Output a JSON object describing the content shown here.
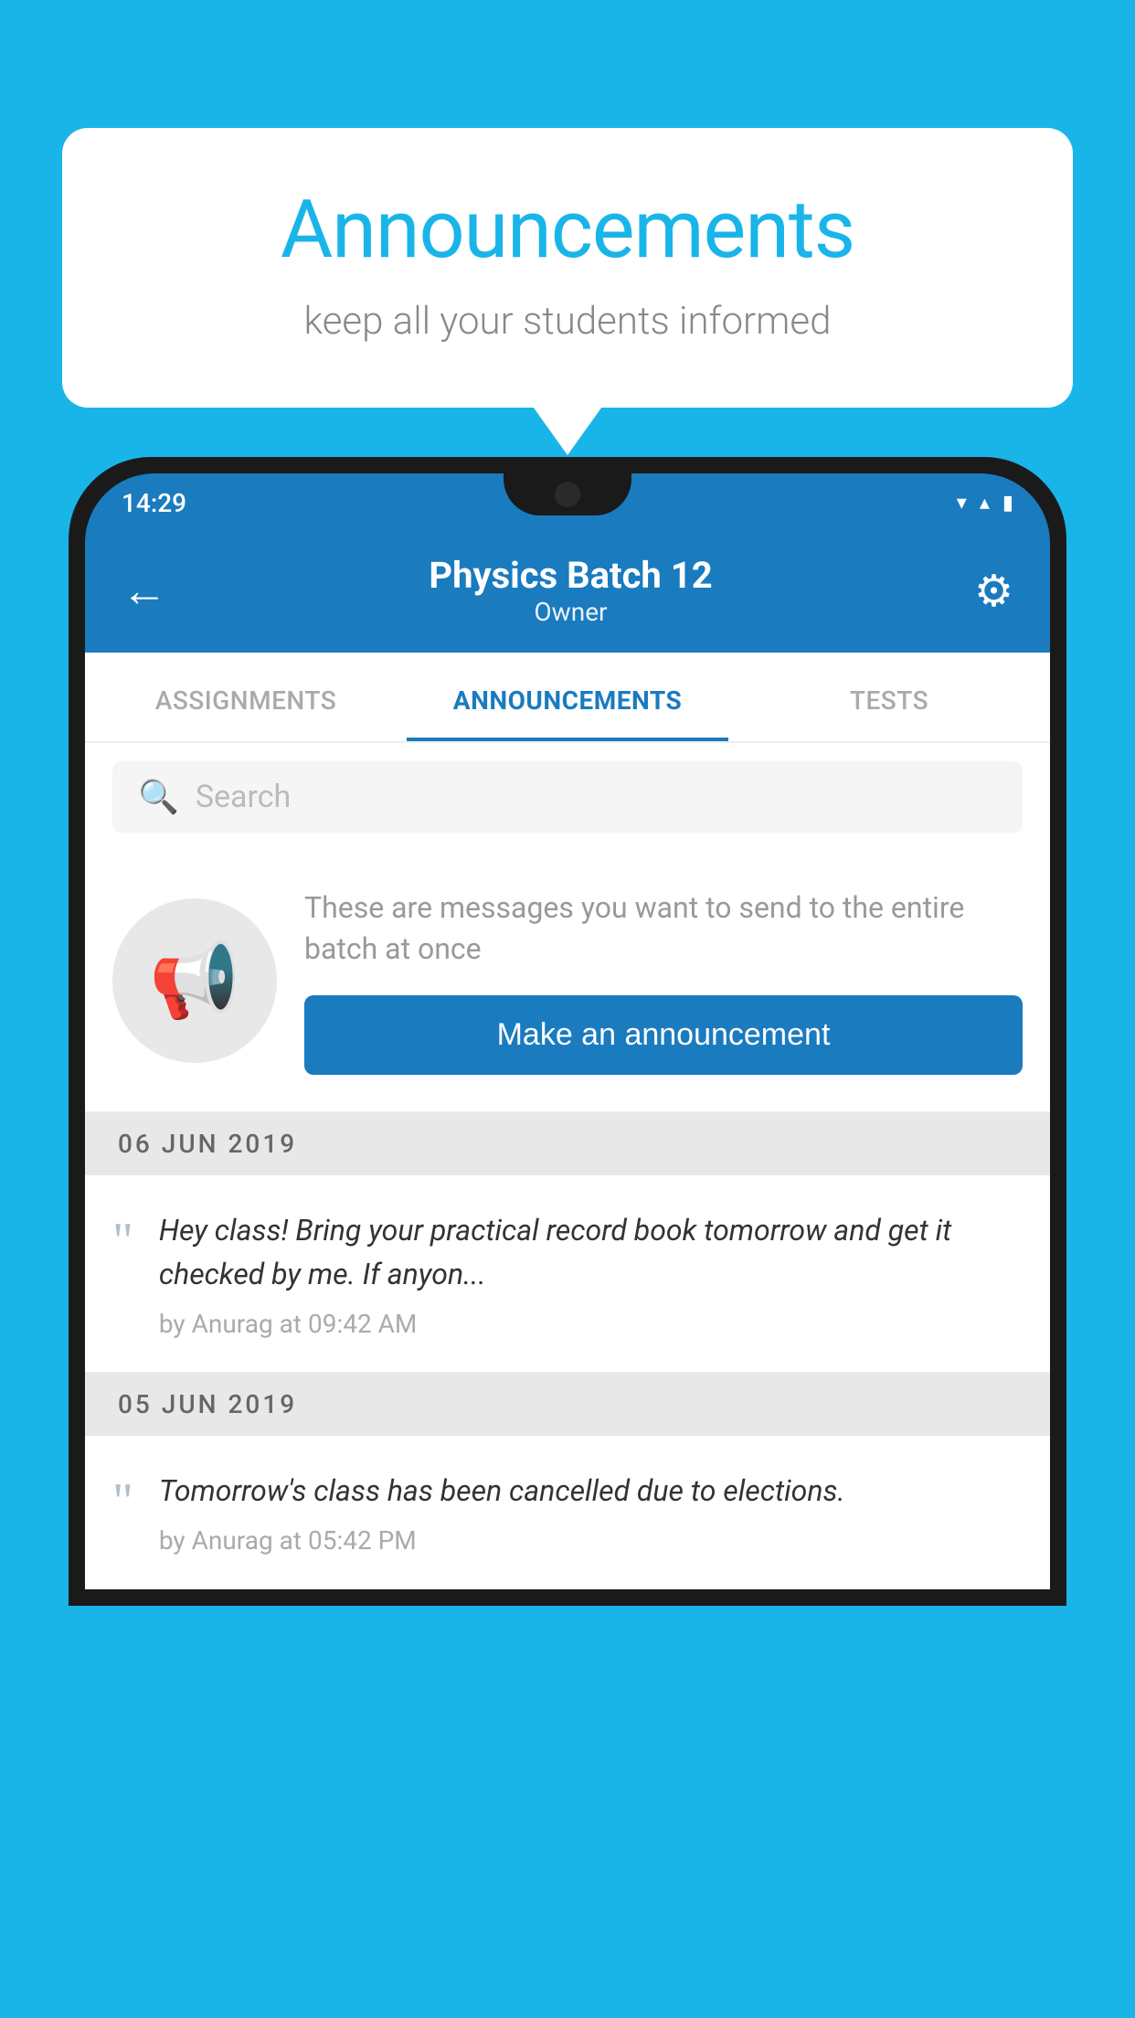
{
  "background_color": "#1ab5e8",
  "bubble": {
    "title": "Announcements",
    "subtitle": "keep all your students informed"
  },
  "phone": {
    "status_bar": {
      "time": "14:29",
      "icons": [
        "wifi",
        "signal",
        "battery"
      ]
    },
    "header": {
      "back_label": "←",
      "title": "Physics Batch 12",
      "subtitle": "Owner",
      "settings_label": "⚙"
    },
    "tabs": [
      {
        "label": "ASSIGNMENTS",
        "active": false
      },
      {
        "label": "ANNOUNCEMENTS",
        "active": true
      },
      {
        "label": "TESTS",
        "active": false
      }
    ],
    "search": {
      "placeholder": "Search"
    },
    "promo": {
      "text": "These are messages you want to send to the entire batch at once",
      "button_label": "Make an announcement"
    },
    "announcements": [
      {
        "date": "06  JUN  2019",
        "text": "Hey class! Bring your practical record book tomorrow and get it checked by me. If anyon...",
        "meta": "by Anurag at 09:42 AM"
      },
      {
        "date": "05  JUN  2019",
        "text": "Tomorrow's class has been cancelled due to elections.",
        "meta": "by Anurag at 05:42 PM"
      }
    ]
  }
}
